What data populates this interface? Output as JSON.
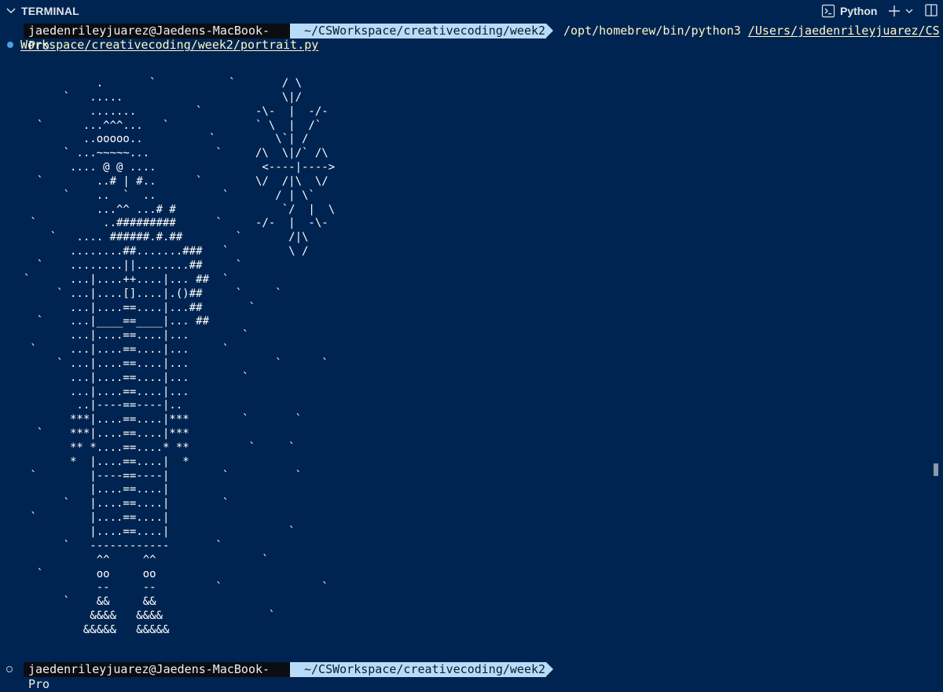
{
  "panel": {
    "title": "TERMINAL",
    "terminal_name": "Python",
    "icons": {
      "collapse": "chevron-down-icon",
      "terminal": "terminal-icon",
      "new_terminal": "plus-icon",
      "launch_profile": "chevron-down-icon",
      "split": "split-panel-icon"
    }
  },
  "prompt1": {
    "user": "jaedenrileyjuarez@Jaedens-MacBook-Pro",
    "dir": "~/CSWorkspace/creativecoding/week2",
    "command_exec": "/opt/homebrew/bin/python3",
    "command_arg": "/Users/jaedenrileyjuarez/CS",
    "command_arg_cont": "Workspace/creativecoding/week2/portrait.py"
  },
  "output": {
    "ascii_art": "           .       `           `       / \\\n      `   .....                        \\|/\n          .......         `        -\\-  |  -/-\n  `      ...^^^...   `             ` \\  |  /`\n         ..ooooo..          `         \\`| /\n      ` ...~~~~~...          `     /\\  \\|/` /\\\n       .... @ @ ....                <----|---->\n  `        ..# | #..      `        \\/  /|\\  \\/\n      `    ..  `  ..          `       / | \\`\n           ...^^ ...# #                `/  |  \\\n `          ..#########      `     -/-  |  -\\-\n    `   .... ######.#.##        `       /|\\\n       ........##.......###   `         \\ /\n  `    ........||........##     `\n`      ...|....++....|... ##  `\n     ` ...|....[]....|.()##     `     `\n       ...|....==....|...##       `\n  `    ...|____==____|... ##\n       ...|....==....|...        `\n `     ...|....==....|...     `\n     ` ...|....==....|...             `      `\n       ...|....==....|...        `\n       ...|....==....|...\n        ..|----==----|..\n       ***|....==....|***        `       `\n  `    ***|....==....|***\n       ** *....==....* **         `     `\n       *  |....==....|  *\n `        |----==----|        `          `\n          |....==....|\n      `   |....==....|        `\n `        |....==....|\n          |....==....|                  `\n      `   ------------       `\n           ^^     ^^                `\n  `        oo     oo\n           --     --         `               `\n      `    &&     &&\n          &&&&   &&&&                `\n         &&&&&   &&&&&"
  },
  "prompt2": {
    "user": "jaedenrileyjuarez@Jaedens-MacBook-Pro",
    "dir": "~/CSWorkspace/creativecoding/week2"
  },
  "colors": {
    "background": "#002451",
    "prompt_user_bg": "#0b0d12",
    "prompt_dir_bg": "#b9dbf8",
    "command_text": "#fff8c6",
    "status_dot": "#4ea0db"
  }
}
